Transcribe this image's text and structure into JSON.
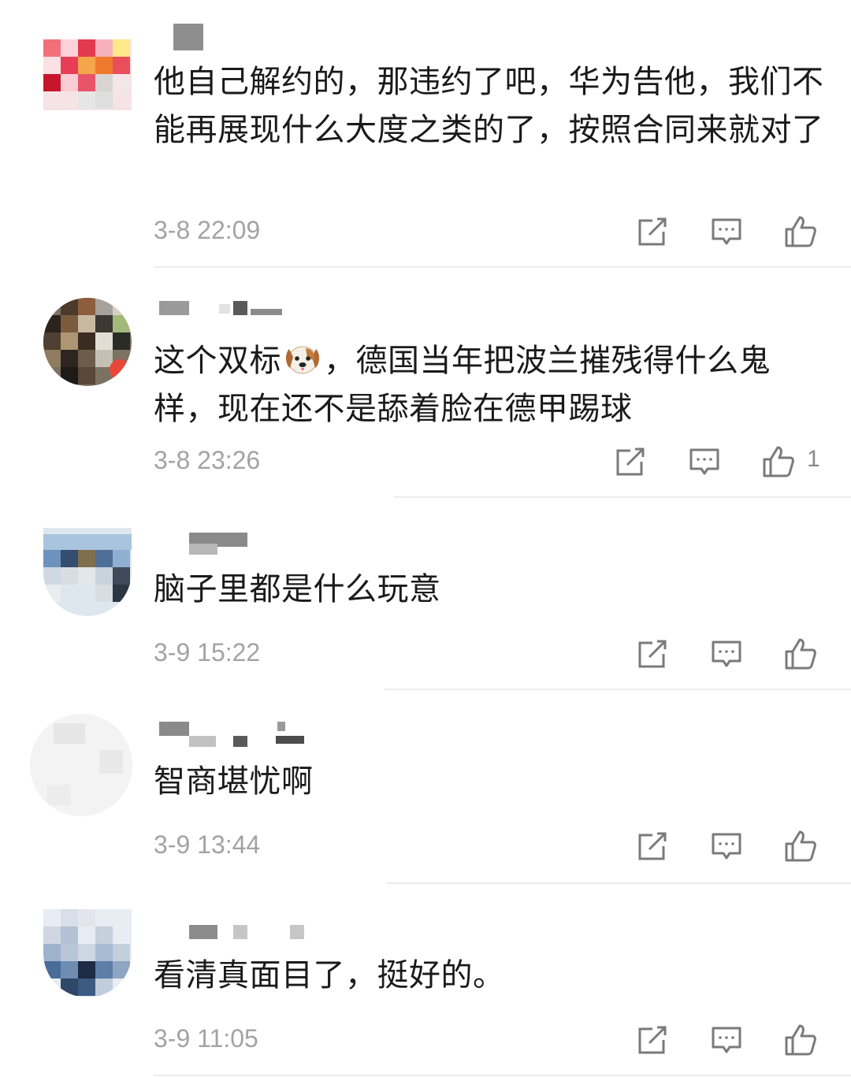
{
  "comments": [
    {
      "username": "",
      "text": "他自己解约的，那违约了吧，华为告他，我们不能再展现什么大度之类的了，按照合同来就对了",
      "time": "3-8 22:09",
      "likes": ""
    },
    {
      "username": "",
      "text_before_emoji": "这个双标",
      "emoji": "dog-face-emoji",
      "text_after_emoji": "，德国当年把波兰摧残得什么鬼样，现在还不是舔着脸在德甲踢球",
      "time": "3-8 23:26",
      "likes": "1"
    },
    {
      "username": "",
      "text": "脑子里都是什么玩意",
      "time": "3-9 15:22",
      "likes": ""
    },
    {
      "username": "",
      "text": "智商堪忧啊",
      "time": "3-9 13:44",
      "likes": ""
    },
    {
      "username": "",
      "text": "看清真面目了，挺好的。",
      "time": "3-9 11:05",
      "likes": ""
    }
  ],
  "icons": {
    "repost": "repost-icon",
    "reply": "comment-icon",
    "like": "thumbs-up-icon"
  },
  "colors": {
    "text": "#1a1a1a",
    "meta": "#a3a3a3",
    "icon": "#7a7a7a",
    "divider": "#ececec"
  }
}
